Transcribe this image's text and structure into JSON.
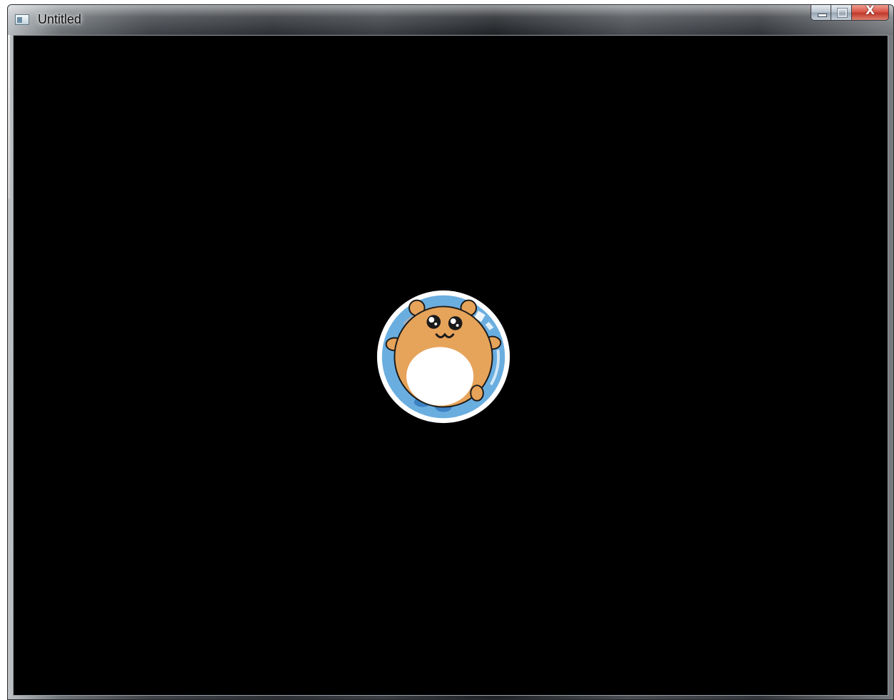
{
  "window": {
    "title": "Untitled",
    "icons": {
      "app": "app-window-icon",
      "minimize": "minimize-icon",
      "maximize": "maximize-icon",
      "close": "close-icon"
    },
    "close_glyph": "X"
  },
  "canvas": {
    "background": "#000000",
    "sprite": {
      "name": "hamster-in-ball",
      "colors": {
        "ball_fill": "#6aaee0",
        "ball_rim": "#ffffff",
        "hamster_fur": "#e6a35a",
        "belly": "#ffffff",
        "outline": "#1a1a1a"
      }
    }
  }
}
